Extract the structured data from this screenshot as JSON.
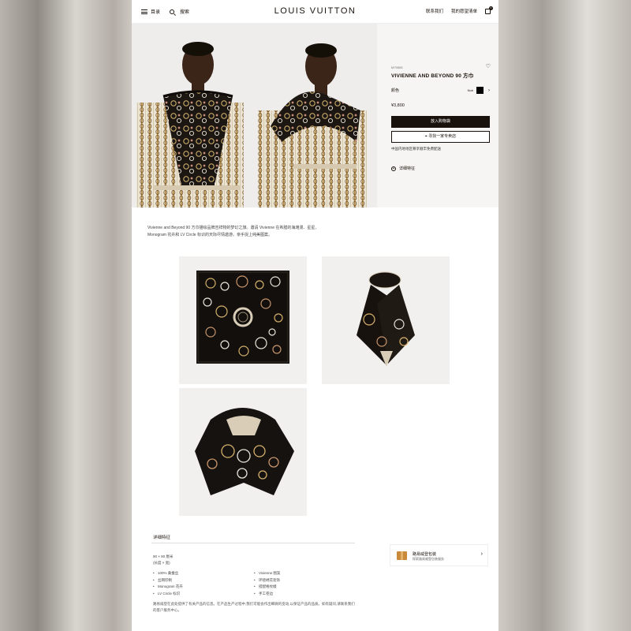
{
  "header": {
    "menu_label": "目录",
    "search_label": "搜索",
    "logo": "LOUIS VUITTON",
    "contact_label": "联系我们",
    "wishlist_label": "我的愿望清单",
    "bag_count": "0"
  },
  "product": {
    "sku": "M79505",
    "title": "VIVIENNE AND BEYOND 90 方巾",
    "color_label": "颜色",
    "color_value": "Noir",
    "swatch_color": "#000000",
    "price": "¥3,800",
    "add_to_bag": "放入购物袋",
    "find_in_store": "寻找一家专卖店",
    "shipping_note": "中国内地地区尊享顺丰免费配送",
    "details_link": "详细特征"
  },
  "description": "Vivienne and Beyond 90 方巾描绘品牌吉祥物的梦幻之旅。邀请 Vivienne 在希腊的海滩漫、星星、Monogram 花卉和 LV Circle 标识的天际尽情遨游。亲手捉上纯美图案。",
  "details": {
    "title": "详细特征",
    "size": "90 × 90 厘米",
    "size_sub": "(长度 × 宽)",
    "features_left": [
      "100% 桑蚕丝",
      "丝网印制",
      "Monogram 花卉",
      "LV Circle 标识"
    ],
    "features_right": [
      "Vivienne 图案",
      "环绕绣花装饰",
      "搭配格纹缀",
      "手工卷边"
    ],
    "footnote": "路易威登在此处提供了有关产品的信息。在产品生产过程中,我们可能会作出细微的变动,以保证产品的品质。如有疑问,请联系我们的客户服务中心。"
  },
  "service": {
    "title": "路易威登包装",
    "subtitle": "探索路易威登包装服务"
  },
  "icons": [
    "menu-icon",
    "search-icon",
    "bag-icon",
    "heart-icon",
    "chevron-right-icon",
    "map-pin-icon",
    "plus-icon",
    "box-icon"
  ]
}
